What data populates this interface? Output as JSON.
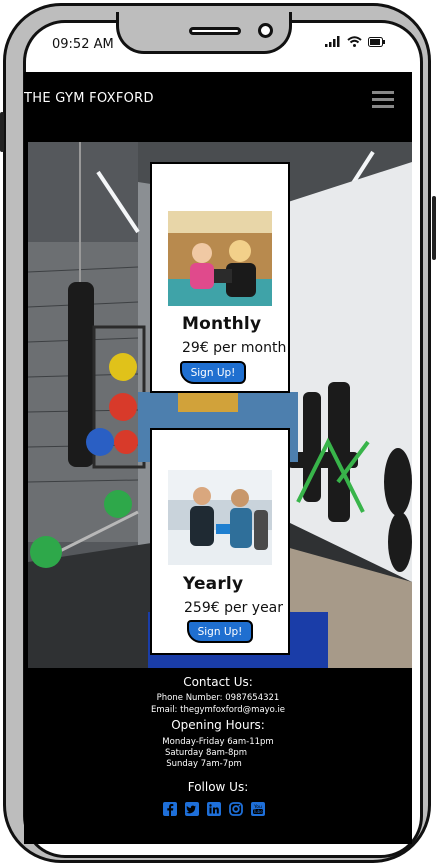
{
  "status_bar": {
    "time": "09:52 AM"
  },
  "navbar": {
    "brand": "THE GYM FOXFORD"
  },
  "cards": [
    {
      "title": "Monthly",
      "price": "29€ per month",
      "button": "Sign Up!"
    },
    {
      "title": "Yearly",
      "price": "259€ per year",
      "button": "Sign Up!"
    }
  ],
  "footer": {
    "contact_heading": "Contact Us:",
    "phone": "Phone Number: 0987654321",
    "email": "Email: thegymfoxford@mayo.ie",
    "hours_heading": "Opening Hours:",
    "hours": [
      "Monday-Friday 6am-11pm",
      "Saturday 8am-8pm",
      "Sunday 7am-7pm"
    ],
    "follow_heading": "Follow Us:",
    "social_icons": [
      "facebook-icon",
      "twitter-icon",
      "linkedin-icon",
      "instagram-icon",
      "youtube-icon"
    ],
    "icon_color": "#1e6fd9"
  },
  "colors": {
    "accent": "#1f6fd0",
    "background": "#000000"
  }
}
